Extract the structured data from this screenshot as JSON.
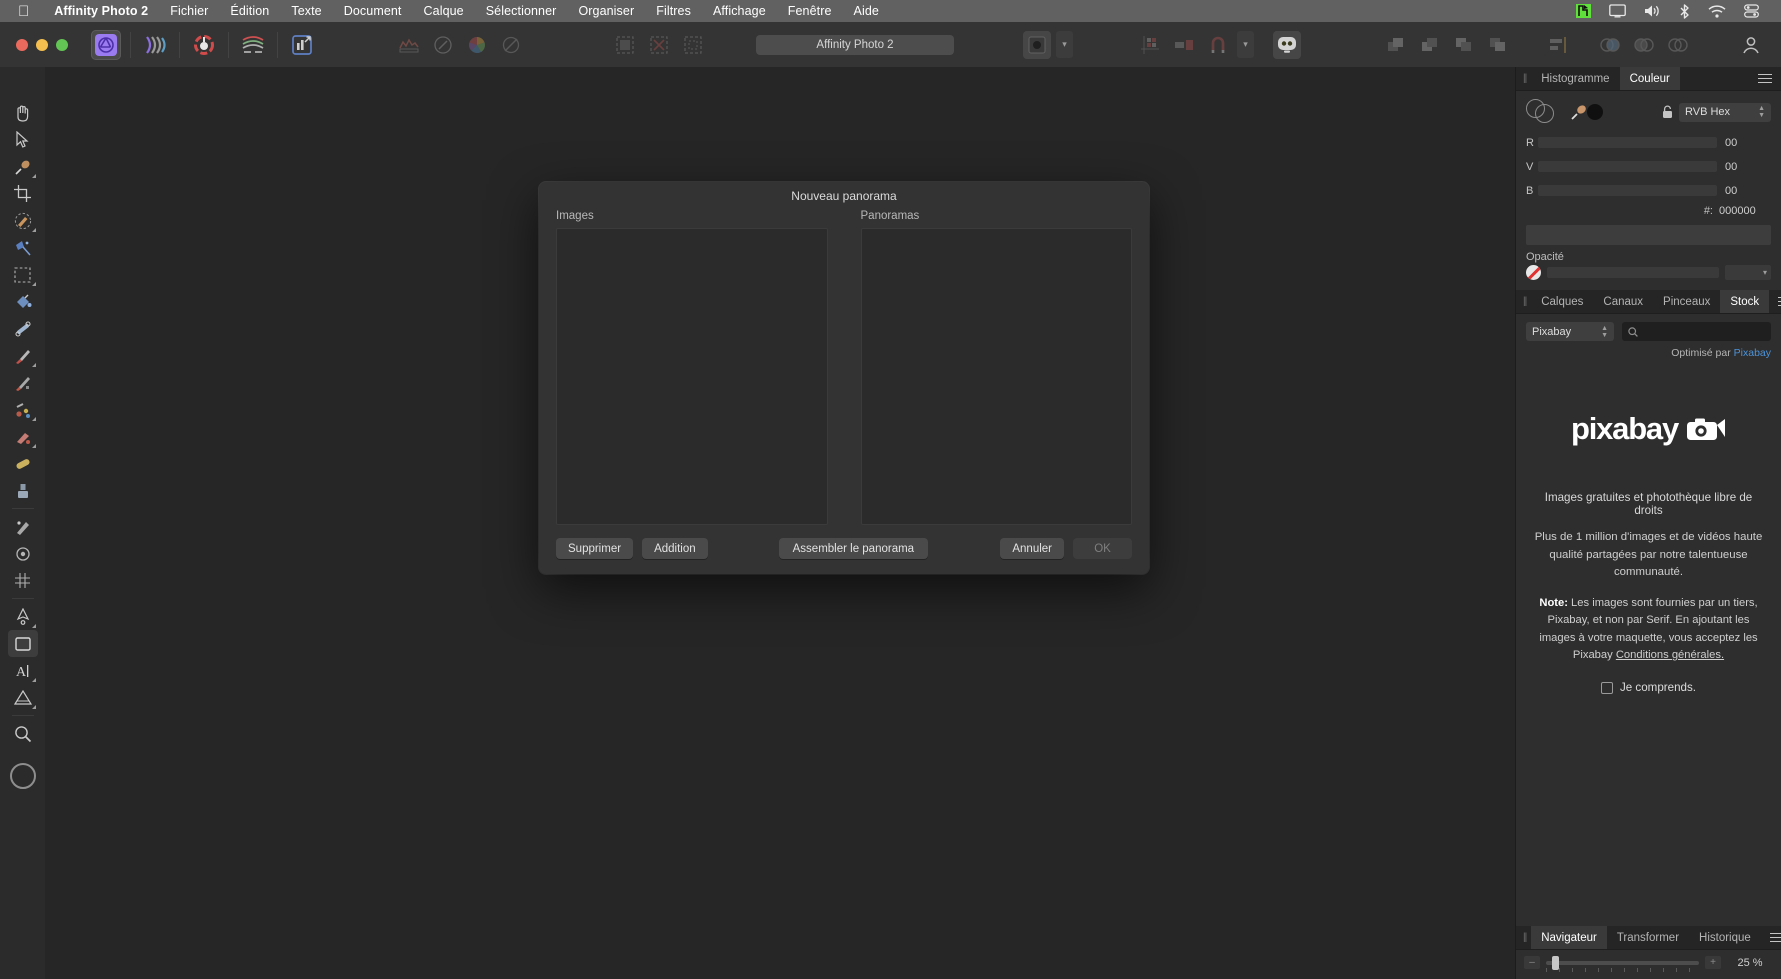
{
  "menubar": {
    "apple": "apple-logo",
    "items": [
      {
        "label": "Affinity Photo 2",
        "bold": true
      },
      {
        "label": "Fichier"
      },
      {
        "label": "Édition"
      },
      {
        "label": "Texte"
      },
      {
        "label": "Document"
      },
      {
        "label": "Calque"
      },
      {
        "label": "Sélectionner"
      },
      {
        "label": "Organiser"
      },
      {
        "label": "Filtres"
      },
      {
        "label": "Affichage"
      },
      {
        "label": "Fenêtre"
      },
      {
        "label": "Aide"
      }
    ],
    "status_icons": [
      "app-status-icon",
      "display-icon",
      "volume-icon",
      "bluetooth-icon",
      "wifi-icon",
      "control-center-icon"
    ]
  },
  "toolbar": {
    "document_title": "Affinity Photo 2",
    "personas": [
      "photo-persona",
      "liquify-persona",
      "develop-persona",
      "tone-mapping-persona",
      "export-persona"
    ],
    "left_tools": [
      "histogram-tool",
      "compass-tool",
      "color-wheel-tool",
      "no-color-tool"
    ],
    "middle_tools": [
      "select-none-icon",
      "deselect-icon",
      "invert-selection-icon"
    ],
    "right_tools": [
      "snapping-icon",
      "grid-icon",
      "align-icon",
      "magnet-icon",
      "assistant-icon"
    ],
    "far_right_tools": [
      "arrange-1",
      "arrange-2",
      "arrange-3",
      "arrange-4",
      "align-tool",
      "group-1",
      "group-2",
      "group-3"
    ],
    "account_icon": "account-icon"
  },
  "tools_panel": {
    "items": [
      {
        "name": "hand-tool",
        "glyph": "✋",
        "has_submenu": false
      },
      {
        "name": "move-tool",
        "glyph": "⬈",
        "has_submenu": false
      },
      {
        "name": "color-picker-tool",
        "glyph": "🥄",
        "has_submenu": true
      },
      {
        "name": "crop-tool",
        "glyph": "⛶",
        "has_submenu": false
      },
      {
        "name": "selection-brush-tool",
        "glyph": "🖌",
        "has_submenu": true
      },
      {
        "name": "flood-select-tool",
        "glyph": "✦",
        "has_submenu": false
      },
      {
        "name": "marquee-tool",
        "glyph": "▫",
        "has_submenu": true
      },
      {
        "name": "paint-bucket-tool",
        "glyph": "🪣",
        "has_submenu": false
      },
      {
        "name": "gradient-tool",
        "glyph": "⟋",
        "has_submenu": false
      },
      {
        "name": "paint-brush-tool",
        "glyph": "🖊",
        "has_submenu": true
      },
      {
        "name": "pixel-tool",
        "glyph": "✎",
        "has_submenu": false
      },
      {
        "name": "erase-brush-tool",
        "glyph": "◣",
        "has_submenu": true
      },
      {
        "name": "smudge-tool",
        "glyph": "☁",
        "has_submenu": false
      },
      {
        "name": "dodge-tool",
        "glyph": "◐",
        "has_submenu": true
      },
      {
        "name": "clone-brush-tool",
        "glyph": "⌾",
        "has_submenu": false
      },
      {
        "name": "inpainting-tool",
        "glyph": "✢",
        "has_submenu": false
      },
      {
        "name": "blemish-removal-tool",
        "glyph": "◍",
        "has_submenu": true
      },
      {
        "name": "mesh-warp-tool",
        "glyph": "#",
        "has_submenu": false
      },
      {
        "name": "pen-tool",
        "glyph": "✒",
        "has_submenu": true
      },
      {
        "name": "rectangle-tool",
        "glyph": "▭",
        "has_submenu": false
      },
      {
        "name": "artistic-text-tool",
        "glyph": "A",
        "has_submenu": true
      },
      {
        "name": "shape-tool",
        "glyph": "⬟",
        "has_submenu": true
      },
      {
        "name": "zoom-tool",
        "glyph": "🔍",
        "has_submenu": false
      }
    ]
  },
  "dialog": {
    "title": "Nouveau panorama",
    "images_label": "Images",
    "panoramas_label": "Panoramas",
    "buttons": {
      "delete": "Supprimer",
      "add": "Addition",
      "stitch": "Assembler le panorama",
      "cancel": "Annuler",
      "ok": "OK"
    }
  },
  "colour_panel": {
    "tabs": [
      {
        "label": "Histogramme",
        "active": false
      },
      {
        "label": "Couleur",
        "active": true
      }
    ],
    "model": "RVB Hex",
    "channels": [
      {
        "label": "R",
        "value": "00"
      },
      {
        "label": "V",
        "value": "00"
      },
      {
        "label": "B",
        "value": "00"
      }
    ],
    "hex_label": "#:",
    "hex_value": "000000",
    "opacity_label": "Opacité",
    "icons": [
      "color-wheel-icon",
      "eyedropper-icon",
      "lock-icon",
      "none-swatch-icon"
    ]
  },
  "stock_panel": {
    "tabs": [
      {
        "label": "Calques",
        "active": false
      },
      {
        "label": "Canaux",
        "active": false
      },
      {
        "label": "Pinceaux",
        "active": false
      },
      {
        "label": "Stock",
        "active": true
      }
    ],
    "source": "Pixabay",
    "search_placeholder": "",
    "powered_prefix": "Optimisé par ",
    "powered_link": "Pixabay",
    "logo_text": "pixabay",
    "heading": "Images gratuites et photothèque libre de droits",
    "paragraph": "Plus de 1 million d'images et de vidéos haute qualité partagées par notre talentueuse communauté.",
    "note_bold": "Note:",
    "note_text": " Les images sont fournies par un tiers, Pixabay, et non par Serif. En ajoutant les images à votre maquette, vous acceptez les Pixabay ",
    "note_link": "Conditions générales.",
    "understand_label": "Je comprends.",
    "understand_checked": false
  },
  "navigator_panel": {
    "tabs": [
      {
        "label": "Navigateur",
        "active": true
      },
      {
        "label": "Transformer",
        "active": false
      },
      {
        "label": "Historique",
        "active": false
      }
    ],
    "zoom_value": "25 %",
    "zoom_out": "–",
    "zoom_in": "+"
  },
  "colors": {
    "menubar_bg": "#616161",
    "toolbar_bg": "#343434",
    "canvas_bg": "#262626",
    "panel_bg": "#2e2e2e",
    "dialog_bg": "#333333",
    "accent_link": "#4d93d9",
    "traffic_red": "#eb6a5e",
    "traffic_yellow": "#f5bf4f",
    "traffic_green": "#62c554"
  }
}
